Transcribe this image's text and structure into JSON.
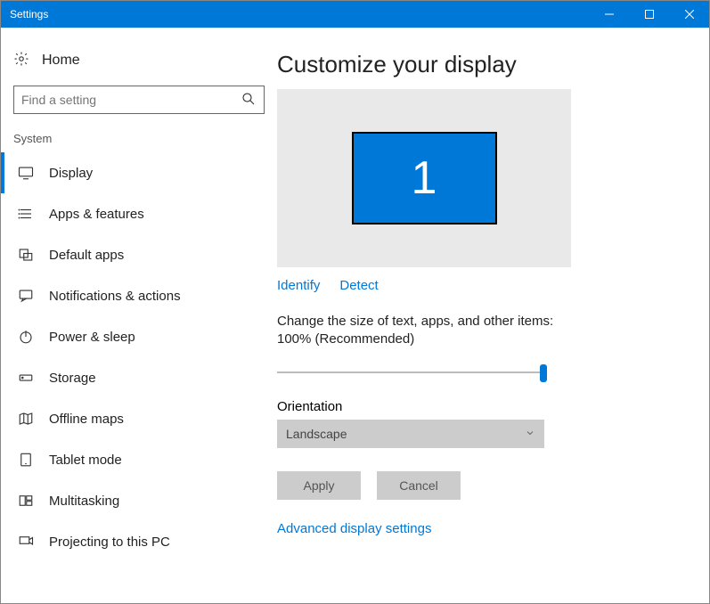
{
  "titlebar": {
    "title": "Settings"
  },
  "sidebar": {
    "home_label": "Home",
    "search_placeholder": "Find a setting",
    "section_label": "System",
    "items": [
      {
        "label": "Display"
      },
      {
        "label": "Apps & features"
      },
      {
        "label": "Default apps"
      },
      {
        "label": "Notifications & actions"
      },
      {
        "label": "Power & sleep"
      },
      {
        "label": "Storage"
      },
      {
        "label": "Offline maps"
      },
      {
        "label": "Tablet mode"
      },
      {
        "label": "Multitasking"
      },
      {
        "label": "Projecting to this PC"
      }
    ]
  },
  "main": {
    "heading": "Customize your display",
    "monitor_number": "1",
    "identify_label": "Identify",
    "detect_label": "Detect",
    "scale_text": "Change the size of text, apps, and other items: 100% (Recommended)",
    "orientation_label": "Orientation",
    "orientation_value": "Landscape",
    "apply_label": "Apply",
    "cancel_label": "Cancel",
    "advanced_label": "Advanced display settings"
  }
}
